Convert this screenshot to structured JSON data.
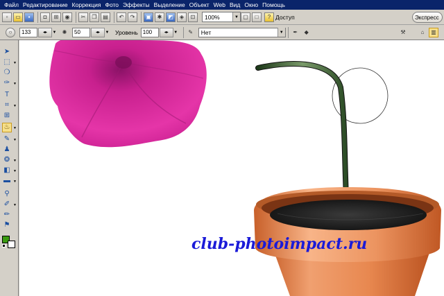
{
  "menu": [
    "Файл",
    "Редактирование",
    "Коррекция",
    "Фото",
    "Эффекты",
    "Выделение",
    "Объект",
    "Web",
    "Вид",
    "Окно",
    "Помощь"
  ],
  "toolbar": {
    "zoom": "100%",
    "access_label": "Доступ",
    "express_label": "Экспресс"
  },
  "options": {
    "size_value": "133",
    "softness_value": "50",
    "level_label": "Уровень",
    "level_value": "100",
    "mode_value": "Нет"
  },
  "colors": {
    "foreground": "#3a9a10",
    "background": "#ffffff",
    "menubar": "#0a246a"
  },
  "canvas": {
    "watermark": "club-photoimpact.ru"
  }
}
